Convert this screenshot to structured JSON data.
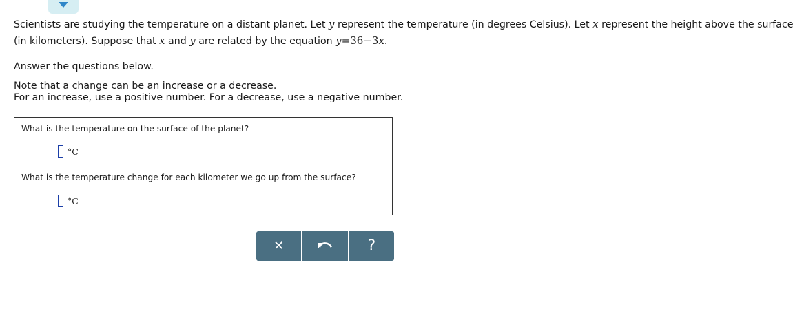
{
  "header": {
    "expand_icon": "chevron-down-icon"
  },
  "problem": {
    "line1_a": "Scientists are studying the temperature on a distant planet. Let ",
    "var_y": "y",
    "line1_b": " represent the temperature (in degrees Celsius). Let ",
    "var_x": "x",
    "line1_c": " represent the height above the surface",
    "line2_a": "(in kilometers). Suppose that ",
    "line2_b": " and ",
    "line2_c": " are related by the equation ",
    "eq_y": "y",
    "eq_rest": "=36−3",
    "eq_x": "x",
    "eq_end": ".",
    "instruction": "Answer the questions below.",
    "note1": "Note that a change can be an increase or a decrease.",
    "note2": "For an increase, use a positive number. For a decrease, use a negative number."
  },
  "questions": [
    {
      "text": "What is the temperature on the surface of the planet?",
      "value": "",
      "unit": "°C"
    },
    {
      "text": "What is the temperature change for each kilometer we go up from the surface?",
      "value": "",
      "unit": "°C"
    }
  ],
  "toolbar": {
    "clear_icon": "close-icon",
    "clear_glyph": "✕",
    "undo_icon": "undo-icon",
    "help_icon": "help-icon",
    "help_glyph": "?"
  },
  "colors": {
    "toolbar_bg": "#4a6f82",
    "tab_bg": "#d6eef3",
    "arrow": "#2f86c8",
    "input_border": "#1c3fa8"
  }
}
